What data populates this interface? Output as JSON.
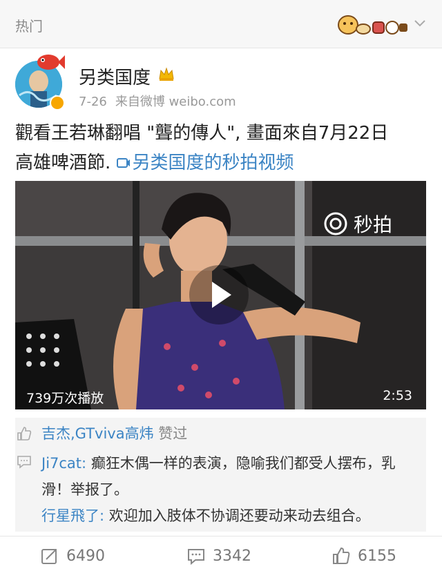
{
  "header": {
    "label": "热门"
  },
  "post": {
    "username": "另类国度",
    "date": "7-26",
    "source": "来自微博 weibo.com",
    "text_line1": "觀看王若琳翻唱 \"聾的傳人\", 畫面來自7月22日",
    "text_line2": "高雄啤酒節.",
    "link_text": "另类国度的秒拍视频",
    "link_color": "#3b84c4"
  },
  "video": {
    "watermark": "秒拍",
    "play_count": "739万次播放",
    "duration": "2:53"
  },
  "likes": {
    "names": "吉杰,GTviva高炜",
    "suffix": "赞过"
  },
  "comments": [
    {
      "user": "Ji7cat",
      "sep": ":",
      "text": "癫狂木偶一样的表演，隐喻我们都受人摆布，乳滑！举报了。"
    },
    {
      "user": "行星飛了",
      "sep": ":",
      "text": "欢迎加入肢体不协调还要动来动去组合。"
    }
  ],
  "actions": {
    "repost_count": "6490",
    "comment_count": "3342",
    "like_count": "6155"
  },
  "icons": [
    "chevron-down-icon",
    "crown-icon",
    "verified-icon",
    "link-video-icon",
    "play-icon",
    "miaopai-icon",
    "like-icon",
    "comment-icon",
    "repost-icon"
  ]
}
